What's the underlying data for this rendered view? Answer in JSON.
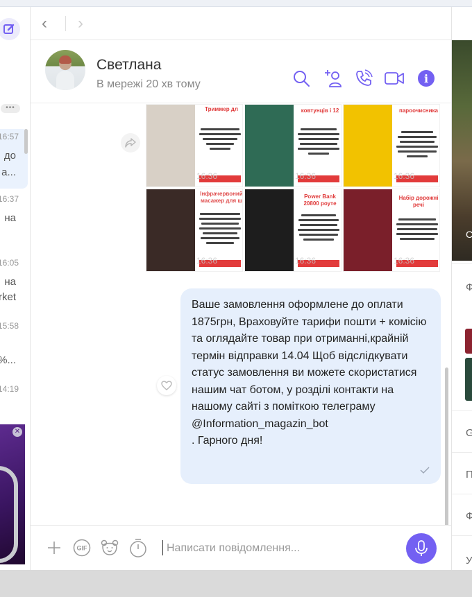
{
  "nav": {
    "back": "‹",
    "forward": "›"
  },
  "contact": {
    "name": "Светлана",
    "status": "В мережі 20 хв тому"
  },
  "chat_list": [
    {
      "time": "16:57",
      "preview_1": "до",
      "preview_2": "а..."
    },
    {
      "time": "16:37",
      "preview_1": "на",
      "preview_2": ""
    },
    {
      "time": "16:05",
      "preview_1": "на",
      "preview_2": "rket"
    },
    {
      "time": "15:58",
      "preview_1": "",
      "preview_2": "%..."
    },
    {
      "time": "14:19",
      "preview_1": "",
      "preview_2": ""
    }
  ],
  "chat_list_more": "•••",
  "products": [
    {
      "title": "Триммер дл",
      "color": "#d8d0c6",
      "stamp": "16:36"
    },
    {
      "title": "ковтунців і 12",
      "color": "#2f6b55",
      "stamp": "16:36"
    },
    {
      "title": "пароочисника",
      "color": "#f2c200",
      "stamp": "16:36"
    },
    {
      "title": "Інфрачервоний масажер для ш",
      "color": "#3a2a26",
      "stamp": "16:36"
    },
    {
      "title": "Power Bank 20800 роуте",
      "color": "#1d1d1d",
      "stamp": "16:36"
    },
    {
      "title": "Набір дорожні речі",
      "color": "#7a1f2a",
      "stamp": "16:36"
    }
  ],
  "message": {
    "text": "Ваше замовлення оформлене до оплати 1875грн, Враховуйте тарифи пошти + комісію  та оглядайте товар при отриманні,крайній термін відправки 14.04 Щоб відслідкувати статус замовлення ви можете скористатися нашим чат ботом, у розділі контакти на нашому сайті з поміткою телеграму\n@Information_magazin_bot\n. Гарного дня!",
    "status_icon": "read-tick"
  },
  "composer": {
    "placeholder": "Написати повідомлення...",
    "gif_label": "GIF"
  },
  "right_pane": {
    "photo_label": "С",
    "items": [
      "Ф",
      "G",
      "П",
      "Ф",
      "У"
    ]
  },
  "colors": {
    "accent": "#7360f2",
    "bubble": "#e6effc"
  }
}
